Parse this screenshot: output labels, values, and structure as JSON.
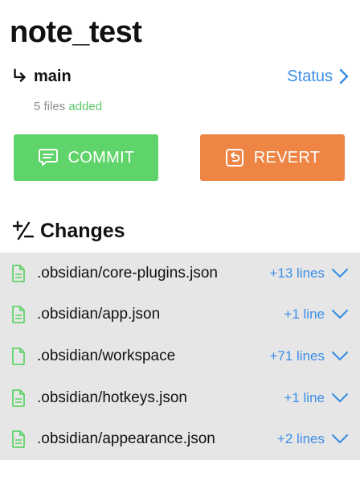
{
  "repo": {
    "title": "note_test"
  },
  "branch": {
    "name": "main",
    "status_label": "Status"
  },
  "summary": {
    "count_text": "5 files",
    "state_text": "added"
  },
  "actions": {
    "commit_label": "COMMIT",
    "revert_label": "REVERT"
  },
  "changes": {
    "title": "Changes",
    "items": [
      {
        "path": ".obsidian/core-plugins.json",
        "lines": "+13 lines"
      },
      {
        "path": ".obsidian/app.json",
        "lines": "+1 line"
      },
      {
        "path": ".obsidian/workspace",
        "lines": "+71 lines"
      },
      {
        "path": ".obsidian/hotkeys.json",
        "lines": "+1 line"
      },
      {
        "path": ".obsidian/appearance.json",
        "lines": "+2 lines"
      }
    ]
  },
  "colors": {
    "accent_blue": "#3c8ee6",
    "commit_green": "#5fd46a",
    "revert_orange": "#ee8544",
    "added_green": "#5cc96a",
    "list_bg": "#e6e6e6"
  },
  "icons": {
    "branch": "branch-arrow-icon",
    "status": "chevron-right-icon",
    "commit": "message-icon",
    "revert": "revert-icon",
    "changes": "plus-minus-icon",
    "file": "file-icon",
    "expand": "chevron-down-icon"
  }
}
